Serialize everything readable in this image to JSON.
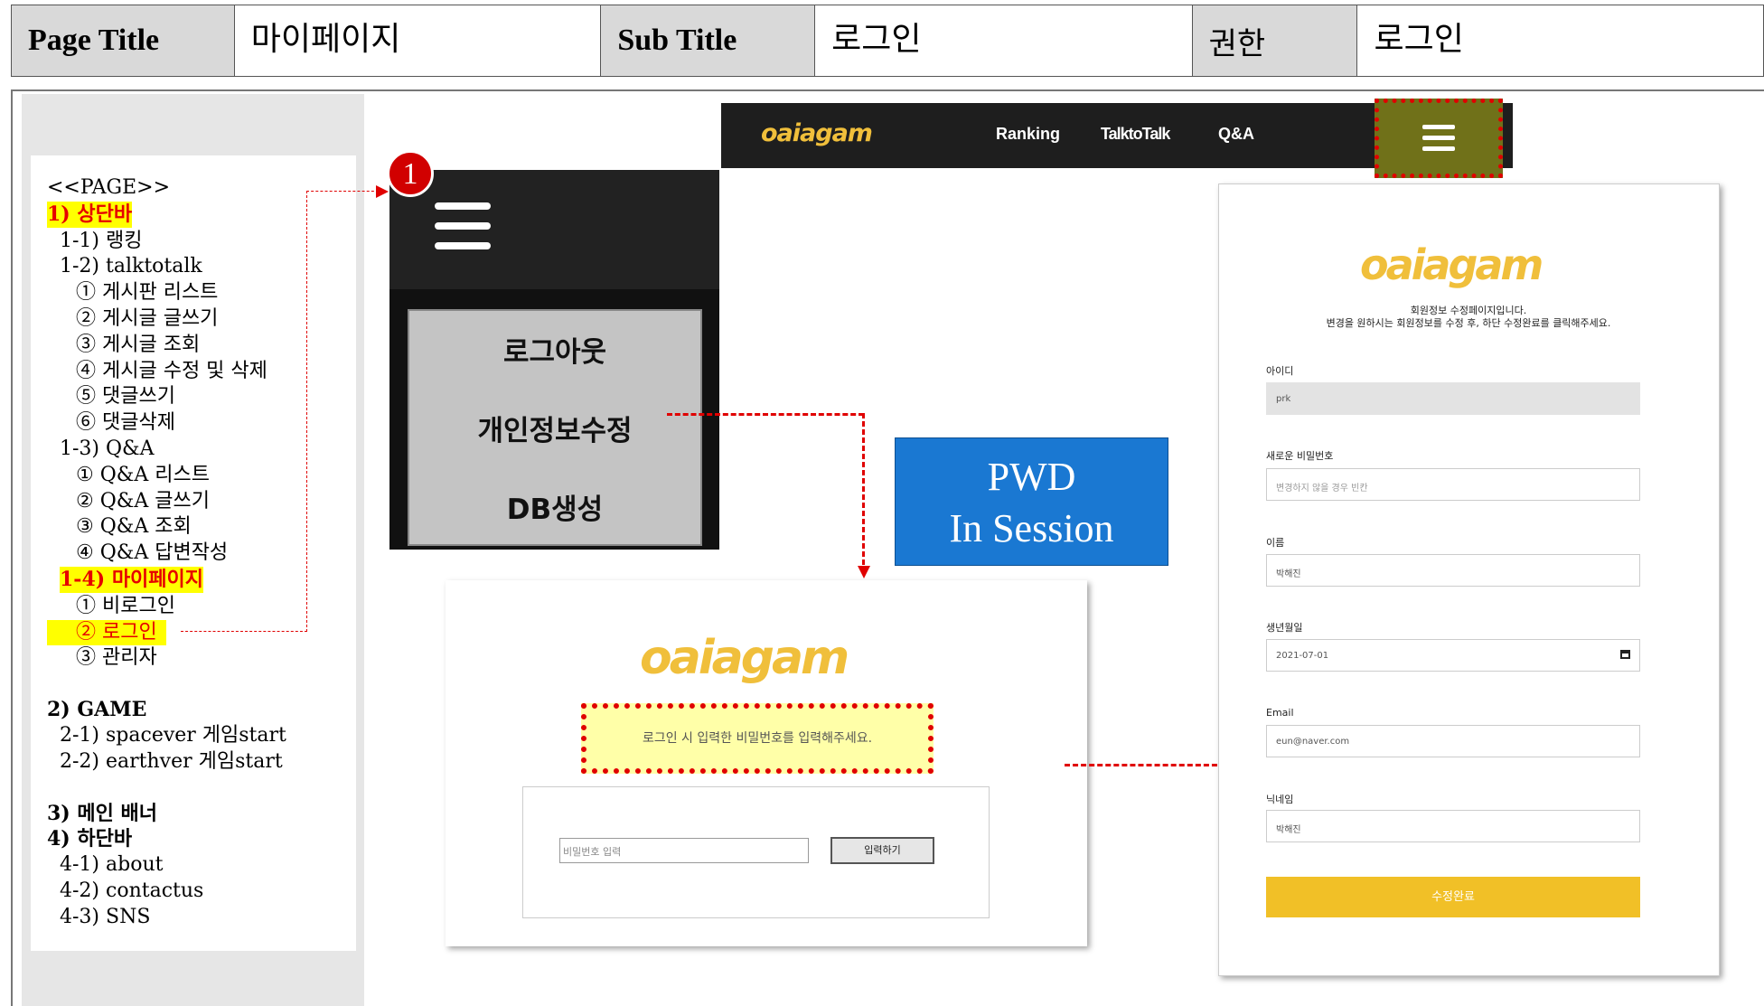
{
  "header": {
    "page_title_label": "Page Title",
    "page_title_value": "마이페이지",
    "sub_title_label": "Sub Title",
    "sub_title_value": "로그인",
    "permission_label": "권한",
    "permission_value": "로그인"
  },
  "sidebar": {
    "page_heading": "<<PAGE>>",
    "items": [
      "1) 상단바",
      "1-1) 랭킹",
      "1-2) talktotalk",
      "① 게시판 리스트",
      "② 게시글 글쓰기",
      "③ 게시글 조회",
      "④ 게시글 수정 및 삭제",
      "⑤ 댓글쓰기",
      "⑥ 댓글삭제",
      "1-3) Q&A",
      "① Q&A 리스트",
      "② Q&A 글쓰기",
      "③ Q&A 조회",
      "④ Q&A 답변작성",
      "1-4) 마이페이지",
      "① 비로그인",
      "② 로그인",
      "③ 관리자",
      "2) GAME",
      "2-1) spacever 게임start",
      "2-2) earthver 게임start",
      "3)  메인 배너",
      "4)  하단바",
      "4-1) about",
      "4-2) contactus",
      "4-3) SNS"
    ]
  },
  "navbar": {
    "brand": "oaiagam",
    "links": [
      "Ranking",
      "TalktoTalk",
      "Q&A"
    ],
    "menu_icon": "hamburger-icon"
  },
  "dropdown": {
    "badge": "1",
    "items": [
      "로그아웃",
      "개인정보수정",
      "DB생성"
    ]
  },
  "pwd_note": {
    "line1": "PWD",
    "line2": "In Session"
  },
  "password_page": {
    "brand": "oaiagam",
    "notice": "로그인 시 입력한 비밀번호를 입력해주세요.",
    "input_placeholder": "비밀번호 입력",
    "submit_label": "입력하기"
  },
  "edit_page": {
    "brand": "oaiagam",
    "intro_line1": "회원정보 수정페이지입니다.",
    "intro_line2": "변경을 원하시는 회원정보를 수정 후, 하단 수정완료를 클릭해주세요.",
    "fields": [
      {
        "label": "아이디",
        "value": "prk"
      },
      {
        "label": "새로운 비밀번호",
        "value": "변경하지 않을 경우 빈칸"
      },
      {
        "label": "이름",
        "value": "박해진"
      },
      {
        "label": "생년월일",
        "value": "2021-07-01"
      },
      {
        "label": "Email",
        "value": "eun@naver.com"
      },
      {
        "label": "닉네임",
        "value": "박해진"
      }
    ],
    "submit_label": "수정완료"
  },
  "colors": {
    "accent_yellow": "#f1c027",
    "highlight": "#ffff00",
    "annotation_red": "#e00000",
    "note_blue": "#1a78d2",
    "navbar_bg": "#1e1e1e"
  }
}
